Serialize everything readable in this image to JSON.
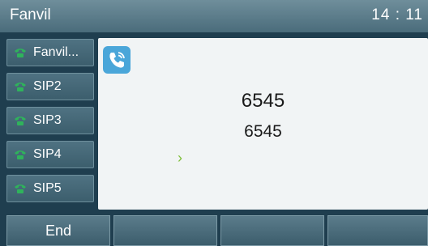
{
  "header": {
    "title": "Fanvil",
    "time": "14 : 11"
  },
  "lines": [
    {
      "label": "Fanvil...",
      "icon": "phone-handset-icon"
    },
    {
      "label": "SIP2",
      "icon": "phone-handset-icon"
    },
    {
      "label": "SIP3",
      "icon": "phone-handset-icon"
    },
    {
      "label": "SIP4",
      "icon": "phone-handset-icon"
    },
    {
      "label": "SIP5",
      "icon": "phone-handset-icon"
    }
  ],
  "call": {
    "icon": "call-icon",
    "number_primary": "6545",
    "number_secondary": "6545",
    "arrow_icon": "chevron-right-icon"
  },
  "softkeys": [
    {
      "label": "End"
    },
    {
      "label": ""
    },
    {
      "label": ""
    },
    {
      "label": ""
    }
  ],
  "colors": {
    "line_icon": "#2fb35b",
    "call_icon_bg": "#4aa6d9",
    "arrow": "#7fbf3a"
  }
}
